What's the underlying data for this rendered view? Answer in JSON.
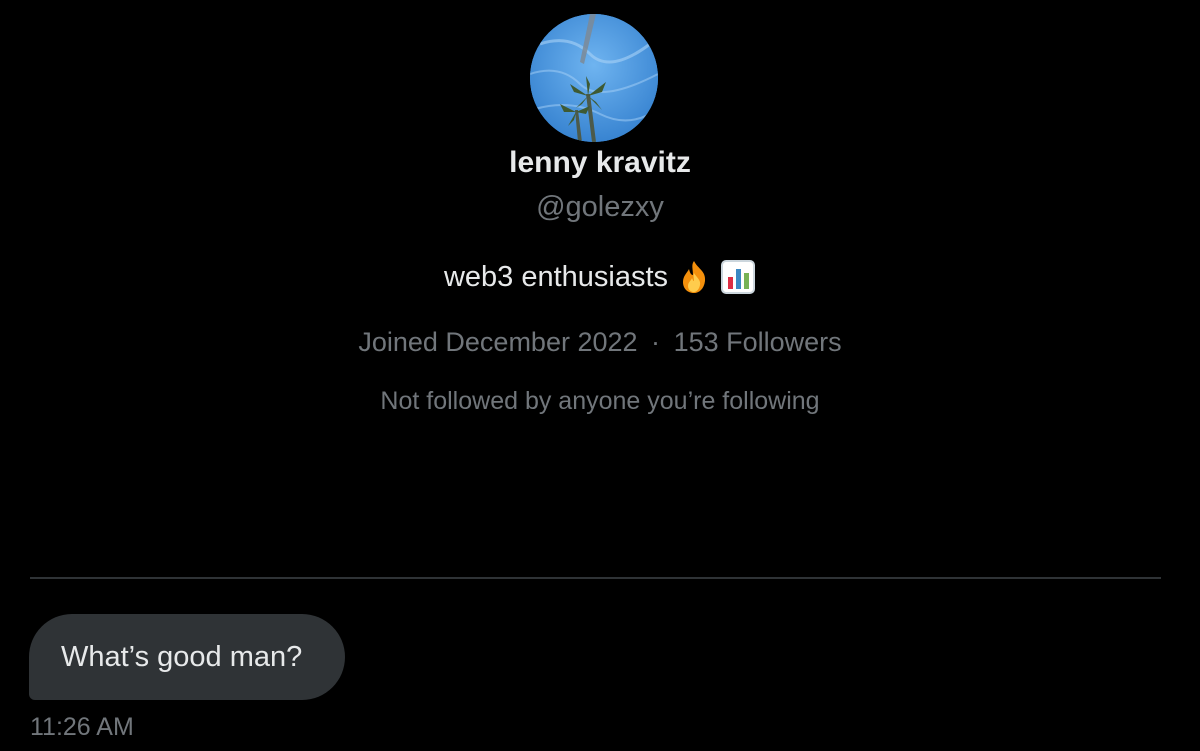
{
  "profile": {
    "display_name": "lenny kravitz",
    "handle": "@golezxy",
    "bio_text": "web3 enthusiasts",
    "bio_emojis": [
      "fire-emoji",
      "bar-chart-emoji"
    ],
    "joined": "Joined December 2022",
    "separator": "·",
    "followers": "153 Followers",
    "mutuals": "Not followed by anyone you’re following"
  },
  "conversation": {
    "messages": [
      {
        "text": "What’s good man?",
        "time": "11:26 AM"
      }
    ]
  },
  "colors": {
    "background": "#000000",
    "primary_text": "#e7e9ea",
    "secondary_text": "#71767b",
    "bubble": "#2f3336",
    "divider": "#2f3336"
  }
}
